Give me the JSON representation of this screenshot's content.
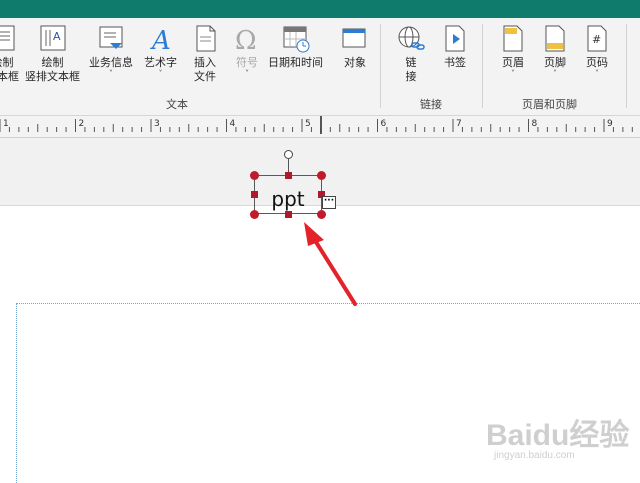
{
  "ribbon": {
    "text_group": {
      "label": "文本",
      "buttons": [
        {
          "id": "draw-textbox",
          "label_line1": "绘制",
          "label_line2": "文本框",
          "icon": "textbox-icon"
        },
        {
          "id": "vertical-textbox",
          "label_line1": "绘制",
          "label_line2": "竖排文本框",
          "icon": "vertical-textbox-icon"
        },
        {
          "id": "business-info",
          "label_line1": "业务信息",
          "label_line2": "˅",
          "icon": "business-info-icon"
        },
        {
          "id": "wordart",
          "label_line1": "艺术字",
          "label_line2": "˅",
          "icon": "wordart-icon"
        },
        {
          "id": "insert-file",
          "label_line1": "插入",
          "label_line2": "文件",
          "icon": "insert-file-icon"
        },
        {
          "id": "symbol",
          "label_line1": "符号",
          "label_line2": "˅",
          "icon": "omega-icon"
        },
        {
          "id": "date-time",
          "label_line1": "日期和时间",
          "label_line2": "",
          "icon": "calendar-clock-icon"
        },
        {
          "id": "object",
          "label_line1": "对象",
          "label_line2": "",
          "icon": "object-icon"
        }
      ]
    },
    "links_group": {
      "label": "链接",
      "buttons": [
        {
          "id": "link",
          "label_line1": "链",
          "label_line2": "接",
          "icon": "globe-link-icon"
        },
        {
          "id": "bookmark",
          "label_line1": "书签",
          "label_line2": "",
          "icon": "bookmark-icon"
        }
      ]
    },
    "header_footer_group": {
      "label": "页眉和页脚",
      "buttons": [
        {
          "id": "header",
          "label_line1": "页眉",
          "label_line2": "˅",
          "icon": "header-icon"
        },
        {
          "id": "footer",
          "label_line1": "页脚",
          "label_line2": "˅",
          "icon": "footer-icon"
        },
        {
          "id": "page-number",
          "label_line1": "页码",
          "label_line2": "˅",
          "icon": "page-number-icon"
        }
      ]
    }
  },
  "ruler": {
    "numbers": [
      "1",
      "2",
      "3",
      "4",
      "5",
      "6",
      "7",
      "8",
      "9"
    ]
  },
  "document": {
    "textbox_text": "ppt"
  },
  "colors": {
    "accent": "#0f7b6c",
    "handle": "#c11b2b",
    "arrow": "#e3222a"
  },
  "watermark": {
    "brand": "Baidu经验",
    "url": "jingyan.baidu.com"
  }
}
